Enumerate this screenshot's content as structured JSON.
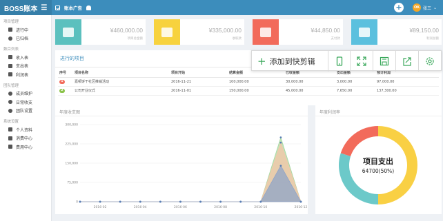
{
  "header": {
    "brand": "BOSS账本",
    "nav_title": "账本广告",
    "plus_label": "+",
    "user_avatar_text": "OK",
    "user_name": "张三"
  },
  "sidebar": {
    "sections": [
      {
        "title": "项目管理",
        "items": [
          {
            "label": "进行中",
            "icon": "layers-icon"
          },
          {
            "label": "已归档",
            "icon": "check-circle-icon"
          }
        ]
      },
      {
        "title": "数目列表",
        "items": [
          {
            "label": "收入表",
            "icon": "upload-icon"
          },
          {
            "label": "支出表",
            "icon": "download-icon"
          },
          {
            "label": "利润表",
            "icon": "money-bag-icon"
          }
        ]
      },
      {
        "title": "团队管理",
        "items": [
          {
            "label": "成员维护",
            "icon": "user-icon"
          },
          {
            "label": "日常收支",
            "icon": "clock-icon"
          },
          {
            "label": "团队设置",
            "icon": "gear-icon"
          }
        ]
      },
      {
        "title": "系统设置",
        "items": [
          {
            "label": "个人资料",
            "icon": "id-card-icon"
          },
          {
            "label": "消费中心",
            "icon": "car-icon"
          },
          {
            "label": "费用中心",
            "icon": "wallet-icon"
          }
        ]
      }
    ]
  },
  "stats": [
    {
      "value": "¥460,000.00",
      "label": "项目总金额",
      "color": "#5bc0be",
      "icon": "coins-icon"
    },
    {
      "value": "¥335,000.00",
      "label": "收取款",
      "color": "#f7d23e",
      "icon": "cash-icon"
    },
    {
      "value": "¥44,850.00",
      "label": "支付款",
      "color": "#f26b5b",
      "icon": "register-icon"
    },
    {
      "value": "¥89,150.00",
      "label": "利润总额",
      "color": "#5bc0de",
      "icon": "money-bag-icon"
    }
  ],
  "projects": {
    "title": "进行的项目",
    "columns": [
      "序号",
      "项目名称",
      "项目开始",
      "结算金额",
      "已收金额",
      "支出金额",
      "预计利润"
    ],
    "rows": [
      {
        "idx": "1",
        "idx_color": "#f26b5b",
        "name": "嘉顿饼干社区推销活动",
        "start": "2016-11-21",
        "settle": "100,000.00",
        "received": "30,000.00",
        "expense": "3,000.00",
        "profit": "97,000.00"
      },
      {
        "idx": "2",
        "idx_color": "#8bc34a",
        "name": "公司开业仪式",
        "start": "2016-11-01",
        "settle": "150,000.00",
        "received": "45,000.00",
        "expense": "7,650.00",
        "profit": "137,300.00"
      }
    ]
  },
  "toolbar": {
    "add_label": "添加到快剪辑",
    "buttons": [
      "phone-icon",
      "expand-icon",
      "save-icon",
      "share-icon",
      "settings-icon"
    ]
  },
  "revenue_chart_title": "年度收支图",
  "profit_chart_title": "年度利润率",
  "chart_data": [
    {
      "type": "area",
      "title": "年度收支图",
      "x": [
        "2016-01",
        "2016-02",
        "2016-03",
        "2016-04",
        "2016-05",
        "2016-06",
        "2016-07",
        "2016-08",
        "2016-09",
        "2016-10",
        "2016-11",
        "2016-12"
      ],
      "xtick_labels": [
        "2016-02",
        "2016-04",
        "2016-06",
        "2016-08",
        "2016-10",
        "2016-12"
      ],
      "ylim": [
        0,
        300000
      ],
      "yticks": [
        0,
        75000,
        150000,
        225000,
        300000
      ],
      "ytick_labels": [
        "0",
        "75,000",
        "150,000",
        "225,000",
        "300,000"
      ],
      "grid": true,
      "series": [
        {
          "color": "#a8d8a0",
          "values": [
            0,
            0,
            0,
            0,
            0,
            0,
            0,
            0,
            0,
            0,
            250000,
            0
          ]
        },
        {
          "color": "#f5c6a8",
          "values": [
            0,
            0,
            0,
            0,
            0,
            0,
            0,
            0,
            0,
            0,
            230000,
            0
          ]
        },
        {
          "color": "#8fa4c8",
          "values": [
            0,
            0,
            0,
            0,
            0,
            0,
            0,
            0,
            0,
            0,
            140000,
            0
          ]
        }
      ]
    },
    {
      "type": "pie",
      "title": "年度利润率",
      "center_title": "项目支出",
      "center_value": "64700(50%)",
      "slices": [
        {
          "value": 50,
          "color": "#f9d044"
        },
        {
          "value": 30,
          "color": "#6cc9c9"
        },
        {
          "value": 20,
          "color": "#f26b5b"
        }
      ]
    }
  ]
}
